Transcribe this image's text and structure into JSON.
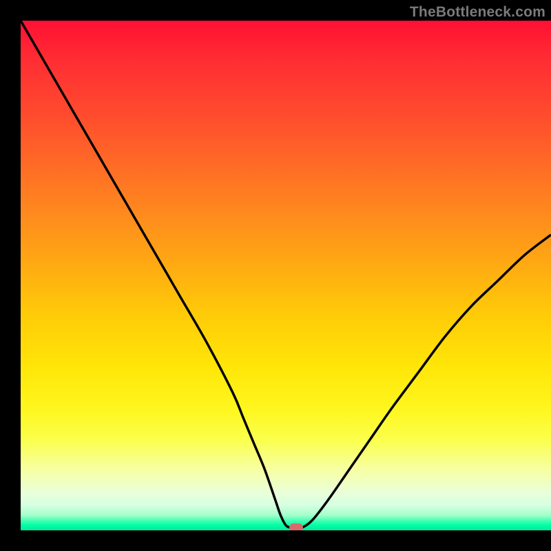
{
  "watermark": "TheBottleneck.com",
  "colors": {
    "curve_stroke": "#000000",
    "marker_fill": "#d86a6a"
  },
  "chart_data": {
    "type": "line",
    "title": "",
    "xlabel": "",
    "ylabel": "",
    "xlim": [
      0,
      100
    ],
    "ylim": [
      0,
      100
    ],
    "grid": false,
    "annotations": [],
    "series": [
      {
        "name": "bottleneck-curve",
        "x": [
          0,
          5,
          10,
          15,
          20,
          25,
          30,
          35,
          40,
          42,
          44,
          46,
          48,
          49,
          50,
          51,
          52,
          53,
          55,
          58,
          62,
          66,
          70,
          75,
          80,
          85,
          90,
          95,
          100
        ],
        "values": [
          100,
          91,
          82,
          73,
          64,
          55,
          46,
          37,
          27,
          22,
          17,
          12,
          6,
          3,
          1,
          0.5,
          0.5,
          0.5,
          2,
          6,
          12,
          18,
          24,
          31,
          38,
          44,
          49,
          54,
          58
        ]
      }
    ],
    "marker": {
      "x": 52,
      "y": 0.5
    }
  }
}
